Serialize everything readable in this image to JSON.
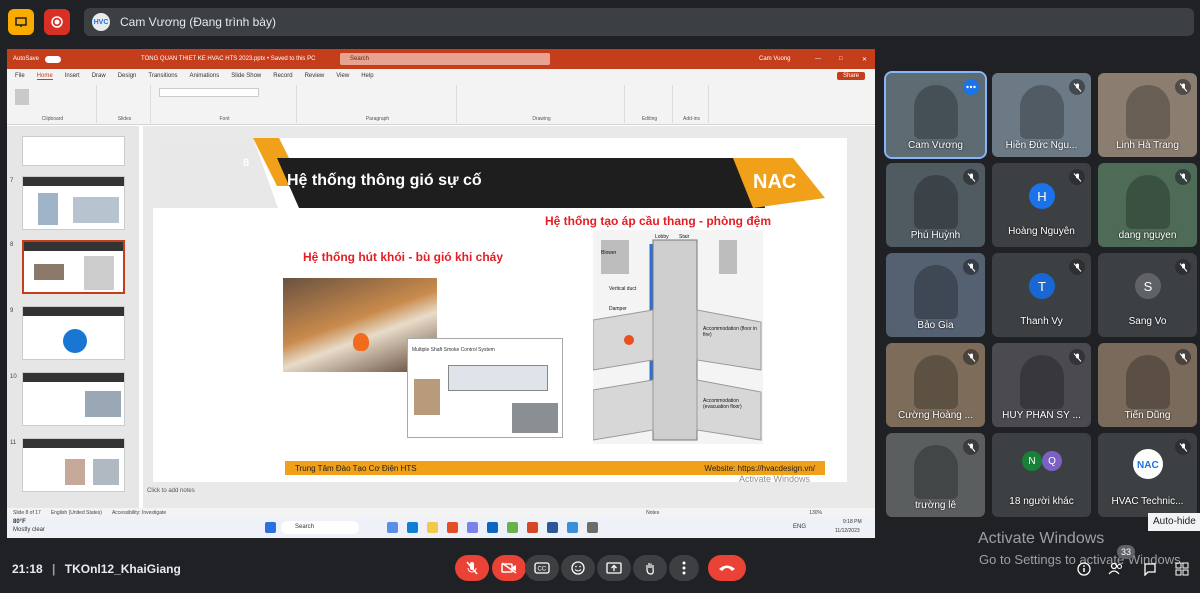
{
  "presenter": {
    "banner": "Cam Vương (Đang trình bày)"
  },
  "ppt": {
    "title_bar": "TONG QUAN THIET KE HVAC HTS 2023.pptx  •  Saved to this PC",
    "search_placeholder": "Search",
    "user": "Cam Vuong",
    "share": "Share",
    "autosave": "AutoSave",
    "menu": [
      "File",
      "Home",
      "Insert",
      "Draw",
      "Design",
      "Transitions",
      "Animations",
      "Slide Show",
      "Record",
      "Review",
      "View",
      "Help"
    ],
    "ribbon_groups": [
      "Clipboard",
      "Slides",
      "Font",
      "Paragraph",
      "Drawing",
      "Editing",
      "Add-ins"
    ],
    "status": {
      "slide": "Slide 8 of 17",
      "lang": "English (United States)",
      "accessibility": "Accessibility: Investigate",
      "notes": "Notes",
      "zoom": "130%"
    },
    "notes_placeholder": "Click to add notes",
    "taskbar": {
      "search": "Search",
      "weather": "80°F",
      "weather_sub": "Mostly clear",
      "lang": "ENG",
      "time": "9:18 PM",
      "date": "11/12/2023"
    }
  },
  "slide": {
    "number": "8",
    "title": "Hệ thống thông gió sự cố",
    "logo": "HVAC",
    "left_heading": "Hệ thống hút khói - bù gió khi cháy",
    "right_heading": "Hệ thống tạo áp cầu thang - phòng đệm",
    "footer_left": "Trung Tâm Đào Tạo Cơ Điện HTS",
    "footer_right": "Website: https://hvacdesign.vn/",
    "diagram_labels": [
      "Blower",
      "Lobby",
      "Stair",
      "Vertical duct",
      "Damper",
      "Accommodation (floor in fire)",
      "Accommodation (evacuation floor)"
    ],
    "inset_title": "Multiple Shaft Smoke Control System"
  },
  "thumbnails": [
    {
      "n": "7"
    },
    {
      "n": "8"
    },
    {
      "n": "9"
    },
    {
      "n": "10"
    },
    {
      "n": "11"
    }
  ],
  "participants": [
    {
      "name": "Cam Vương"
    },
    {
      "name": "Hiền Đức Ngu..."
    },
    {
      "name": "Linh Hà Trang"
    },
    {
      "name": "Phú Huỳnh"
    },
    {
      "name": "Hoàng Nguyễn",
      "initial": "H",
      "color": "#1a73e8"
    },
    {
      "name": "dang nguyen"
    },
    {
      "name": "Bảo Gia"
    },
    {
      "name": "Thanh Vy",
      "initial": "T",
      "color": "#1967d2"
    },
    {
      "name": "Sang Vo",
      "initial": "S",
      "color": "#5f6368"
    },
    {
      "name": "Cường Hoàng ..."
    },
    {
      "name": "HUY PHAN SỸ ..."
    },
    {
      "name": "Tiến Dũng"
    },
    {
      "name": "trường lê"
    },
    {
      "name": "18 người khác",
      "initials": [
        "N",
        "Q"
      ]
    },
    {
      "name": "HVAC Technic..."
    }
  ],
  "bottom": {
    "time": "21:18",
    "meeting": "TKOnl12_KhaiGiang"
  },
  "windows_watermark": {
    "line1": "Activate Windows",
    "line2": "Go to Settings to activate Windows.",
    "inner1": "Activate Windows",
    "inner2": "Go to Settings to activate Windows."
  },
  "tooltip": "Auto-hide",
  "badge_count": "33"
}
